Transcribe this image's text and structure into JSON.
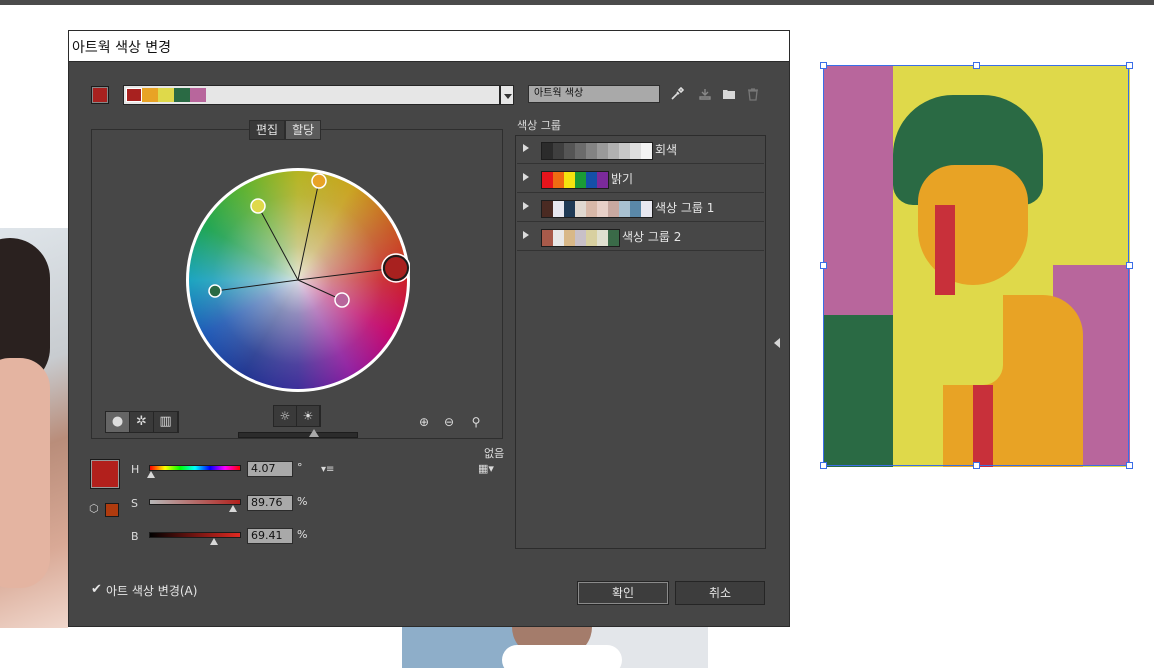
{
  "dialog": {
    "title": "아트웍 색상 변경",
    "artwork_colors_name": "아트웍 색상",
    "current_color": "#a8211f",
    "color_strip": [
      "#a8211f",
      "#e8a325",
      "#dfd94a",
      "#2a6a44",
      "#b8669c"
    ],
    "tabs": [
      {
        "label": "편집",
        "active": false
      },
      {
        "label": "할당",
        "active": true
      }
    ],
    "wheel_handles": [
      {
        "name": "main-red",
        "color": "#a8211f"
      },
      {
        "name": "orange",
        "color": "#e8a325"
      },
      {
        "name": "yellow",
        "color": "#dfd94a"
      },
      {
        "name": "green",
        "color": "#2a6a44"
      },
      {
        "name": "pink",
        "color": "#b8669c"
      }
    ],
    "hsb": {
      "h_label": "H",
      "s_label": "S",
      "b_label": "B",
      "h_value": "4.07",
      "s_value": "89.76",
      "b_value": "69.41",
      "h_unit": "°",
      "s_unit": "%",
      "b_unit": "%",
      "h_level": 0.011,
      "s_level": 0.8976,
      "b_level": 0.6941
    },
    "big_swatch_color": "#b2201c",
    "small_swatch_color": "#b03b0e",
    "none_label": "없음",
    "groups_label": "색상 그룹",
    "color_groups": [
      {
        "name": "회색",
        "colors": [
          "#2b2b2b",
          "#3f3f3f",
          "#555555",
          "#6b6b6b",
          "#838383",
          "#9a9a9a",
          "#b1b1b1",
          "#c8c8c8",
          "#dedede",
          "#f3f3f3"
        ]
      },
      {
        "name": "밝기",
        "colors": [
          "#e8141c",
          "#f06c12",
          "#f4e50f",
          "#1a9b35",
          "#1450a8",
          "#7b2a9a"
        ]
      },
      {
        "name": "색상 그룹 1",
        "colors": [
          "#4a2a22",
          "#e8e8f0",
          "#1f3a55",
          "#e0d8d0",
          "#d8b8a8",
          "#e8d0c8",
          "#c8a8a0",
          "#a8c0d0",
          "#5a88a8",
          "#e8e8f0"
        ]
      },
      {
        "name": "색상 그룹 2",
        "colors": [
          "#a85a4a",
          "#e8e8e8",
          "#d8b888",
          "#c8c0c8",
          "#d8d0a0",
          "#e0e0d0",
          "#3a6a48"
        ]
      }
    ],
    "recolor_art_label": "아트 색상 변경(A)",
    "recolor_art_checked": true,
    "ok_label": "확인",
    "cancel_label": "취소"
  }
}
